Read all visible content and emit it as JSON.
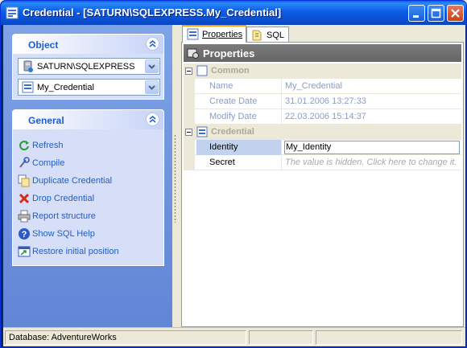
{
  "window": {
    "title": "Credential - [SATURN\\SQLEXPRESS.My_Credential]",
    "accent_color": "#0a5fe8"
  },
  "left": {
    "object_panel": {
      "title": "Object",
      "server_combo": {
        "value": "SATURN\\SQLEXPRESS",
        "icon": "server-icon"
      },
      "object_combo": {
        "value": "My_Credential",
        "icon": "credential-icon"
      }
    },
    "general_panel": {
      "title": "General",
      "items": [
        {
          "label": "Refresh",
          "icon": "refresh-icon"
        },
        {
          "label": "Compile",
          "icon": "compile-icon"
        },
        {
          "label": "Duplicate Credential",
          "icon": "duplicate-icon"
        },
        {
          "label": "Drop Credential",
          "icon": "drop-icon"
        },
        {
          "label": "Report structure",
          "icon": "printer-icon"
        },
        {
          "label": "Show SQL Help",
          "icon": "help-icon"
        },
        {
          "label": "Restore initial position",
          "icon": "restore-icon"
        }
      ]
    }
  },
  "tabs": [
    {
      "label": "Properties",
      "active": true
    },
    {
      "label": "SQL",
      "active": false
    }
  ],
  "properties": {
    "header": "Properties",
    "categories": [
      {
        "name": "Common",
        "rows": [
          {
            "name": "Name",
            "value": "My_Credential"
          },
          {
            "name": "Create Date",
            "value": "31.01.2006 13:27:33"
          },
          {
            "name": "Modify Date",
            "value": "22.03.2006 15:14:37"
          }
        ]
      },
      {
        "name": "Credential",
        "rows": [
          {
            "name": "Identity",
            "value": "My_Identity"
          },
          {
            "name": "Secret",
            "value": "The value is hidden. Click here to change it."
          }
        ]
      }
    ]
  },
  "statusbar": {
    "database": "Database: AdventureWorks"
  }
}
